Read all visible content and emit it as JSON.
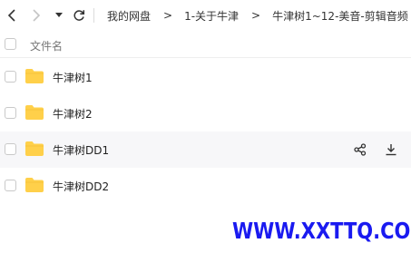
{
  "nav": {
    "back_icon": "chevron-left-icon",
    "forward_icon": "chevron-right-icon",
    "history_icon": "caret-down-icon",
    "refresh_icon": "refresh-icon"
  },
  "breadcrumb": {
    "items": [
      "我的网盘",
      "1-关于牛津",
      "牛津树1~12-美音-剪辑音频"
    ],
    "separator": ">"
  },
  "list": {
    "header_label": "文件名",
    "rows": [
      {
        "name": "牛津树1"
      },
      {
        "name": "牛津树2"
      },
      {
        "name": "牛津树DD1"
      },
      {
        "name": "牛津树DD2"
      }
    ],
    "row_actions": [
      "share-icon",
      "download-icon"
    ]
  },
  "watermark": "WWW.XXTTQ.COM",
  "colors": {
    "folder": "#FFD04A",
    "watermark": "#1A1AF0",
    "hover_row": "#F7F7F9"
  }
}
